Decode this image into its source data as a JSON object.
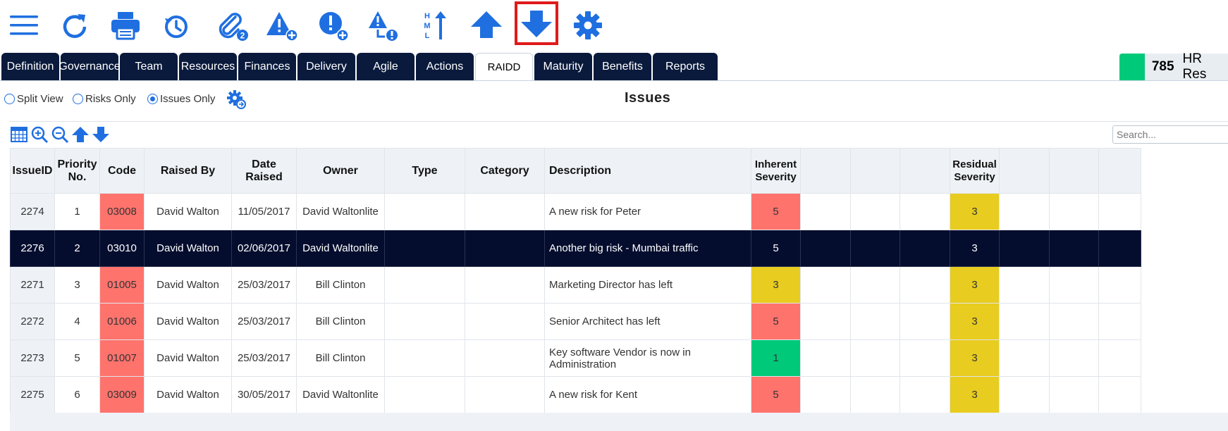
{
  "colors": {
    "navy": "#0a1a3c",
    "accent": "#1f6fe0",
    "selected_outline": "#e01a1a",
    "sev_red": "#ff736d",
    "sev_yellow": "#e8cc20",
    "sev_green": "#00c97a",
    "project_green": "#00c97a"
  },
  "toolbar": {
    "icons": [
      "menu-icon",
      "refresh-icon",
      "print-icon",
      "history-icon",
      "attachment-icon",
      "add-risk-icon",
      "add-issue-icon",
      "escalate-risk-icon",
      "priority-sort-icon",
      "move-up-icon",
      "move-down-icon",
      "settings-icon"
    ],
    "attachment_count": "2",
    "priority_letters": "HML"
  },
  "tabs": [
    "Definition",
    "Governance",
    "Team",
    "Resources",
    "Finances",
    "Delivery",
    "Agile",
    "Actions",
    "RAIDD",
    "Maturity",
    "Benefits",
    "Reports"
  ],
  "active_tab": "RAIDD",
  "project": {
    "id": "785",
    "name": "HR Res"
  },
  "view_options": [
    {
      "label": "Split View",
      "selected": false
    },
    {
      "label": "Risks Only",
      "selected": false
    },
    {
      "label": "Issues Only",
      "selected": true
    }
  ],
  "page_title": "Issues",
  "grid_tools": [
    "calendar-grid-icon",
    "zoom-in-icon",
    "zoom-out-icon",
    "arrow-up-icon",
    "arrow-down-icon"
  ],
  "search": {
    "placeholder": "Search...",
    "value": ""
  },
  "table": {
    "headers": {
      "issue_id": "IssueID",
      "priority": "Priority No.",
      "code": "Code",
      "raised_by": "Raised By",
      "date_raised": "Date Raised",
      "owner": "Owner",
      "type": "Type",
      "category": "Category",
      "description": "Description",
      "inherent_severity": "Inherent Severity",
      "residual_severity": "Residual Severity"
    },
    "rows": [
      {
        "id": "2274",
        "priority": "1",
        "code": "03008",
        "code_color": "red",
        "raised_by": "David Walton",
        "date": "11/05/2017",
        "owner": "David Waltonlite",
        "type": "",
        "category": "",
        "description": "A new risk for Peter",
        "inherent": "5",
        "inherent_color": "red",
        "residual": "3",
        "residual_color": "yellow",
        "selected": false
      },
      {
        "id": "2276",
        "priority": "2",
        "code": "03010",
        "code_color": "red",
        "raised_by": "David Walton",
        "date": "02/06/2017",
        "owner": "David Waltonlite",
        "type": "",
        "category": "",
        "description": "Another big risk - Mumbai traffic",
        "inherent": "5",
        "inherent_color": "red",
        "residual": "3",
        "residual_color": "yellow",
        "selected": true
      },
      {
        "id": "2271",
        "priority": "3",
        "code": "01005",
        "code_color": "red",
        "raised_by": "David Walton",
        "date": "25/03/2017",
        "owner": "Bill Clinton",
        "type": "",
        "category": "",
        "description": "Marketing Director has left",
        "inherent": "3",
        "inherent_color": "yellow",
        "residual": "3",
        "residual_color": "yellow",
        "selected": false
      },
      {
        "id": "2272",
        "priority": "4",
        "code": "01006",
        "code_color": "red",
        "raised_by": "David Walton",
        "date": "25/03/2017",
        "owner": "Bill Clinton",
        "type": "",
        "category": "",
        "description": "Senior Architect has left",
        "inherent": "5",
        "inherent_color": "red",
        "residual": "3",
        "residual_color": "yellow",
        "selected": false
      },
      {
        "id": "2273",
        "priority": "5",
        "code": "01007",
        "code_color": "red",
        "raised_by": "David Walton",
        "date": "25/03/2017",
        "owner": "Bill Clinton",
        "type": "",
        "category": "",
        "description": "Key software Vendor is now in Administration",
        "inherent": "1",
        "inherent_color": "green",
        "residual": "3",
        "residual_color": "yellow",
        "selected": false
      },
      {
        "id": "2275",
        "priority": "6",
        "code": "03009",
        "code_color": "red",
        "raised_by": "David Walton",
        "date": "30/05/2017",
        "owner": "David Waltonlite",
        "type": "",
        "category": "",
        "description": "A new risk for Kent",
        "inherent": "5",
        "inherent_color": "red",
        "residual": "3",
        "residual_color": "yellow",
        "selected": false
      }
    ]
  }
}
